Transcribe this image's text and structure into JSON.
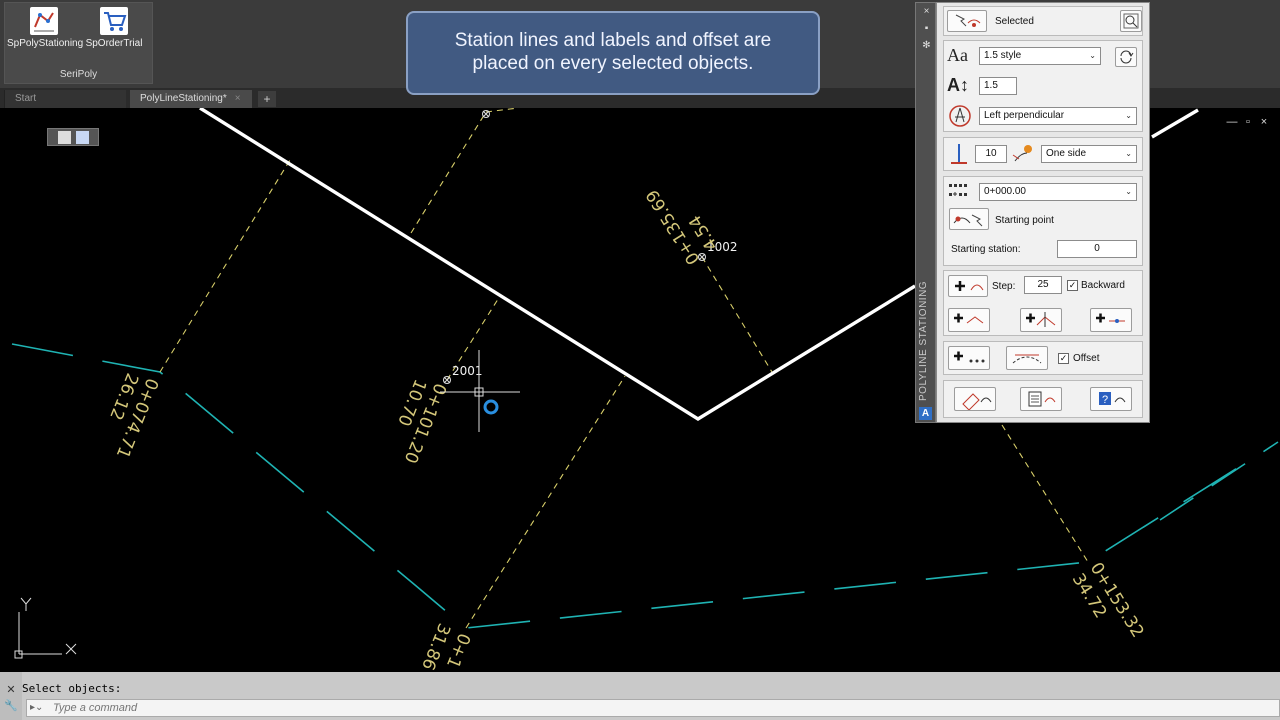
{
  "ribbon": {
    "buttons": [
      {
        "label": "SpPolyStationing",
        "icon": "poly-stationing-icon"
      },
      {
        "label": "SpOrderTrial",
        "icon": "shopping-cart-icon"
      }
    ],
    "group_label": "SeriPoly"
  },
  "tabs": [
    {
      "label": "Start"
    },
    {
      "label": "PolyLineStationing*"
    }
  ],
  "tab_add": "+",
  "tab_close": "×",
  "banner": {
    "line1": "Station lines and labels and offset are",
    "line2": "placed on every selected objects."
  },
  "drawing": {
    "point_labels": [
      "2001",
      "1002"
    ],
    "station_labels": [
      {
        "text": "0+074.71"
      },
      {
        "text": "26.12"
      },
      {
        "text": "0+101.20"
      },
      {
        "text": "10.70"
      },
      {
        "text": "0+135.69"
      },
      {
        "text": "4.54"
      },
      {
        "text": "0+153.32"
      },
      {
        "text": "34.72"
      },
      {
        "text": "0+1"
      },
      {
        "text": "31.86"
      }
    ],
    "ucs": {
      "x": "X",
      "y": "Y"
    }
  },
  "window_controls": [
    "—",
    "▫",
    "×"
  ],
  "palette": {
    "title": "POLYLINE STATIONING",
    "logo": "A",
    "controls": [
      "×",
      "▪",
      "✻"
    ],
    "selected_label": "Selected",
    "text_style_icon": "Aa",
    "text_style": "1.5 style",
    "text_height_icon": "A↕",
    "text_height": "1.5",
    "label_orientation": "Left perpendicular",
    "tick_length": "10",
    "side_option": "One side",
    "station_format": "0+000.00",
    "starting_point_label": "Starting point",
    "starting_station_label": "Starting station:",
    "starting_station": "0",
    "step_label": "Step:",
    "step": "25",
    "backward_label": "Backward",
    "backward_checked": true,
    "offset_label": "Offset",
    "offset_checked": true,
    "checkmark": "✓",
    "dropdown_arrow": "⌄"
  },
  "command_line": {
    "history": "Select objects:",
    "placeholder": "Type a command",
    "side_icons": [
      "✕",
      "🔧"
    ]
  },
  "colors": {
    "canvas": "#000000",
    "polyline": "#ffffff",
    "station_lines": "#d8cf6a",
    "station_labels": "#d4c77a",
    "offset_line": "#1fb3b3",
    "banner": "#415a82"
  }
}
